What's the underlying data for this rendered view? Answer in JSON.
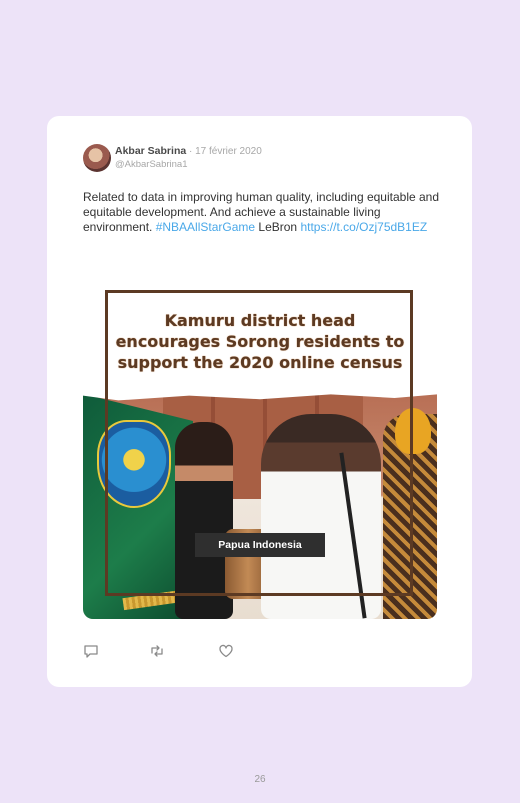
{
  "tweet": {
    "author_name": "Akbar Sabrina",
    "date": "· 17 février 2020",
    "handle": "@AkbarSabrina1",
    "text_main": "Related to data in improving human quality, including equitable and equitable development. And achieve a sustainable living environment. ",
    "hashtag": "#NBAAllStarGame",
    "text_after": " LeBron ",
    "link": "https://t.co/Ozj75dB1EZ"
  },
  "media": {
    "headline": "Kamuru district head encourages Sorong residents to support the 2020 online census",
    "credit": "Papua Indonesia"
  },
  "actions": {
    "reply_icon": "reply-icon",
    "retweet_icon": "retweet-icon",
    "like_icon": "heart-icon"
  },
  "page_number": "26"
}
